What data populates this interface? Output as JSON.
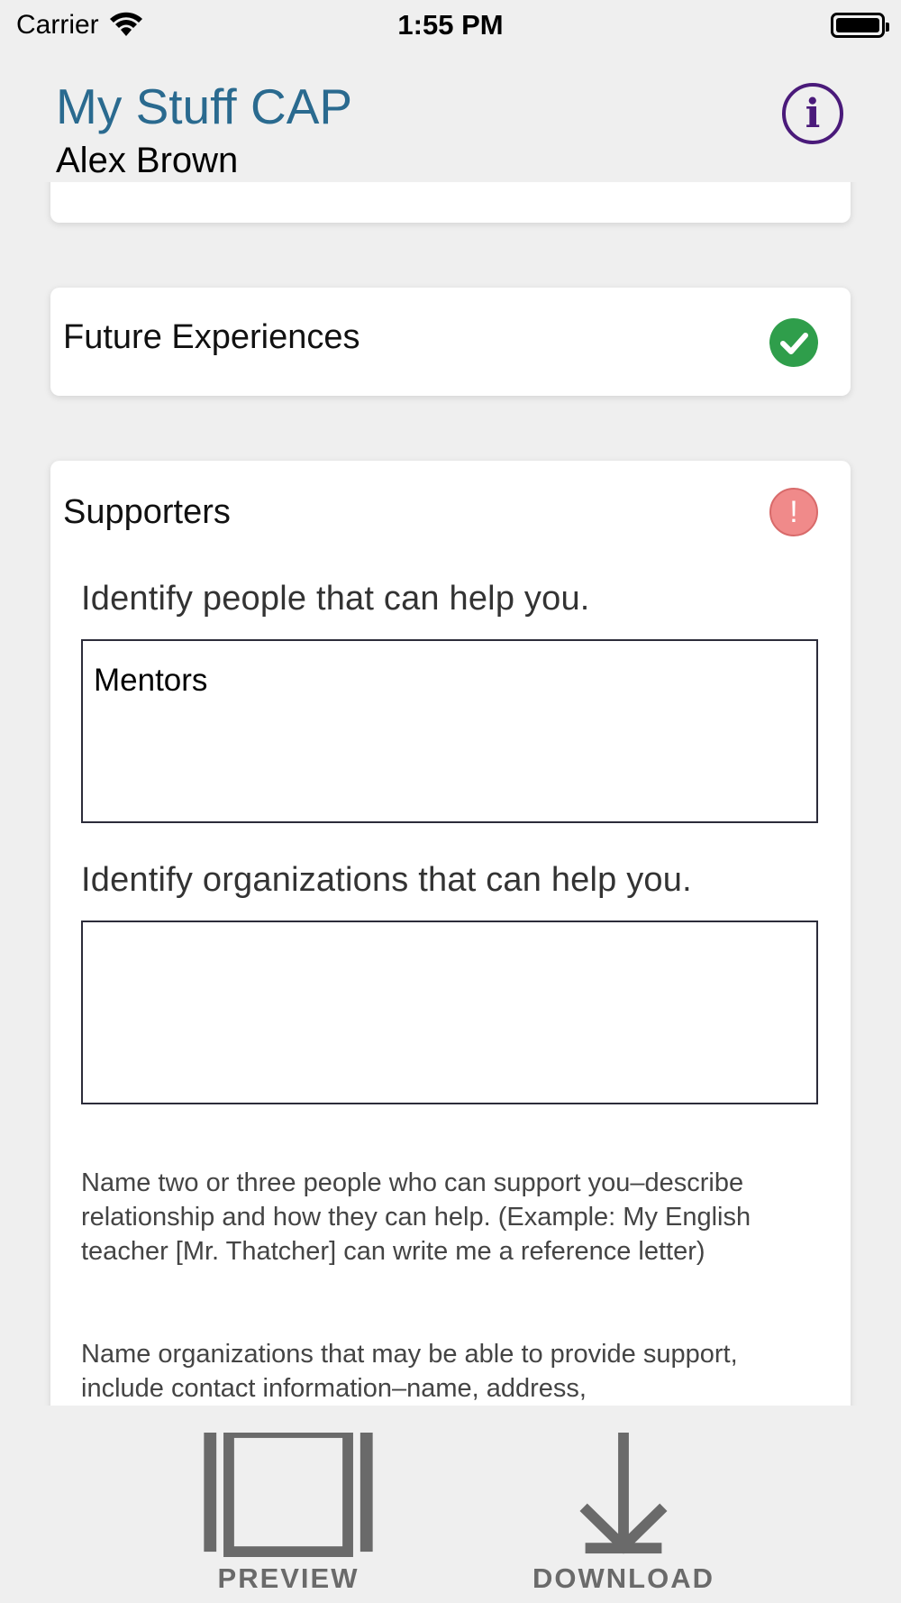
{
  "status_bar": {
    "carrier": "Carrier",
    "time": "1:55 PM"
  },
  "header": {
    "app_title": "My Stuff CAP",
    "user_name": "Alex Brown",
    "info_icon": "info-icon"
  },
  "sections": {
    "future_experiences": {
      "title": "Future Experiences",
      "status": "complete",
      "status_color": "#2f9e4b"
    },
    "supporters": {
      "title": "Supporters",
      "status": "incomplete",
      "status_color": "#f08a8a",
      "alert_glyph": "!",
      "people_prompt": "Identify people that can help you.",
      "people_value": "Mentors",
      "orgs_prompt": "Identify organizations that can help you.",
      "orgs_value": "",
      "help_1": "Name two or three people who can support you–describe relationship and how they can help. (Example: My English teacher [Mr. Thatcher] can write me a reference letter)",
      "help_2": "Name organizations that may be able to provide support, include contact information–name, address,"
    }
  },
  "bottom_bar": {
    "preview_label": "PREVIEW",
    "download_label": "DOWNLOAD"
  },
  "colors": {
    "accent_title": "#2a6a8f",
    "info_purple": "#4a1a7a",
    "bar_icon_gray": "#6a6a6a"
  }
}
